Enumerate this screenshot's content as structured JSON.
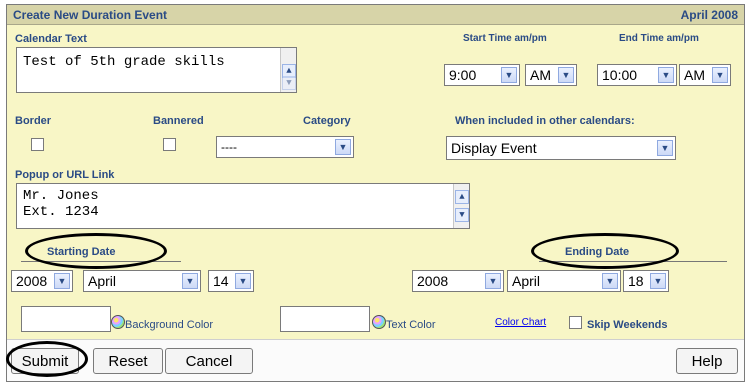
{
  "window": {
    "title": "Create New Duration Event",
    "month": "April 2008"
  },
  "labels": {
    "calendar_text": "Calendar Text",
    "start_time": "Start Time am/pm",
    "end_time": "End Time am/pm",
    "border": "Border",
    "bannered": "Bannered",
    "category": "Category",
    "when_included": "When included in other calendars:",
    "popup_link": "Popup or URL Link",
    "starting_date": "Starting Date",
    "ending_date": "Ending Date",
    "background_color": "Background Color",
    "text_color": "Text Color",
    "color_chart": "Color Chart",
    "skip_weekends": "Skip Weekends"
  },
  "fields": {
    "calendar_text_value": "Test of 5th grade skills",
    "popup_value": "Mr. Jones\nExt. 1234",
    "start_hour": "9:00",
    "start_ampm": "AM",
    "end_hour": "10:00",
    "end_ampm": "AM",
    "category": "----",
    "when_included": "Display Event",
    "start_year": "2008",
    "start_month": "April",
    "start_day": "14",
    "end_year": "2008",
    "end_month": "April",
    "end_day": "18"
  },
  "buttons": {
    "submit": "Submit",
    "reset": "Reset",
    "cancel": "Cancel",
    "help": "Help"
  },
  "icons": {
    "dropdown": "chevron-down-icon",
    "palette": "palette-icon",
    "scroll_up": "scroll-up-icon",
    "scroll_down": "scroll-down-icon"
  },
  "colors": {
    "panel_bg": "#f8f6c6",
    "title_bg": "#d7d4a8",
    "label": "#2a4b85"
  }
}
